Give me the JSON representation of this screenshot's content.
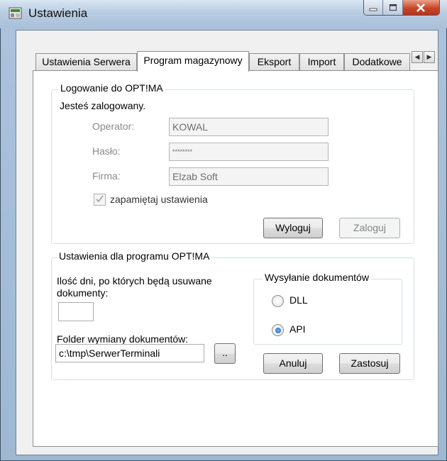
{
  "window": {
    "title": "Ustawienia"
  },
  "tabs": [
    {
      "label": "Ustawienia Serwera"
    },
    {
      "label": "Program magazynowy"
    },
    {
      "label": "Eksport"
    },
    {
      "label": "Import"
    },
    {
      "label": "Dodatkowe"
    }
  ],
  "active_tab": "Program magazynowy",
  "login": {
    "legend": "Logowanie do OPT!MA",
    "status": "Jesteś zalogowany.",
    "operator_label": "Operator:",
    "operator_value": "KOWAL",
    "password_label": "Hasło:",
    "password_value": "********",
    "company_label": "Firma:",
    "company_value": "Elzab Soft",
    "remember_label": "zapamiętaj ustawienia",
    "remember_checked": true,
    "logout_button": "Wyloguj",
    "login_button": "Zaloguj"
  },
  "settings": {
    "legend": "Ustawienia dla programu OPT!MA",
    "days_label": "Ilość dni, po których będą usuwane dokumenty:",
    "days_value": "",
    "folder_label": "Folder wymiany dokumentów:",
    "folder_value": "c:\\tmp\\SerwerTerminali",
    "browse_button": "..",
    "sending_legend": "Wysyłanie dokumentów",
    "options": [
      {
        "label": "DLL",
        "selected": false
      },
      {
        "label": "API",
        "selected": true
      }
    ],
    "cancel_button": "Anuluj",
    "apply_button": "Zastosuj"
  },
  "colors": {
    "title_bar": "#b8cce1",
    "close_button": "#c8452a",
    "radio_selected": "#1c5fb3"
  }
}
